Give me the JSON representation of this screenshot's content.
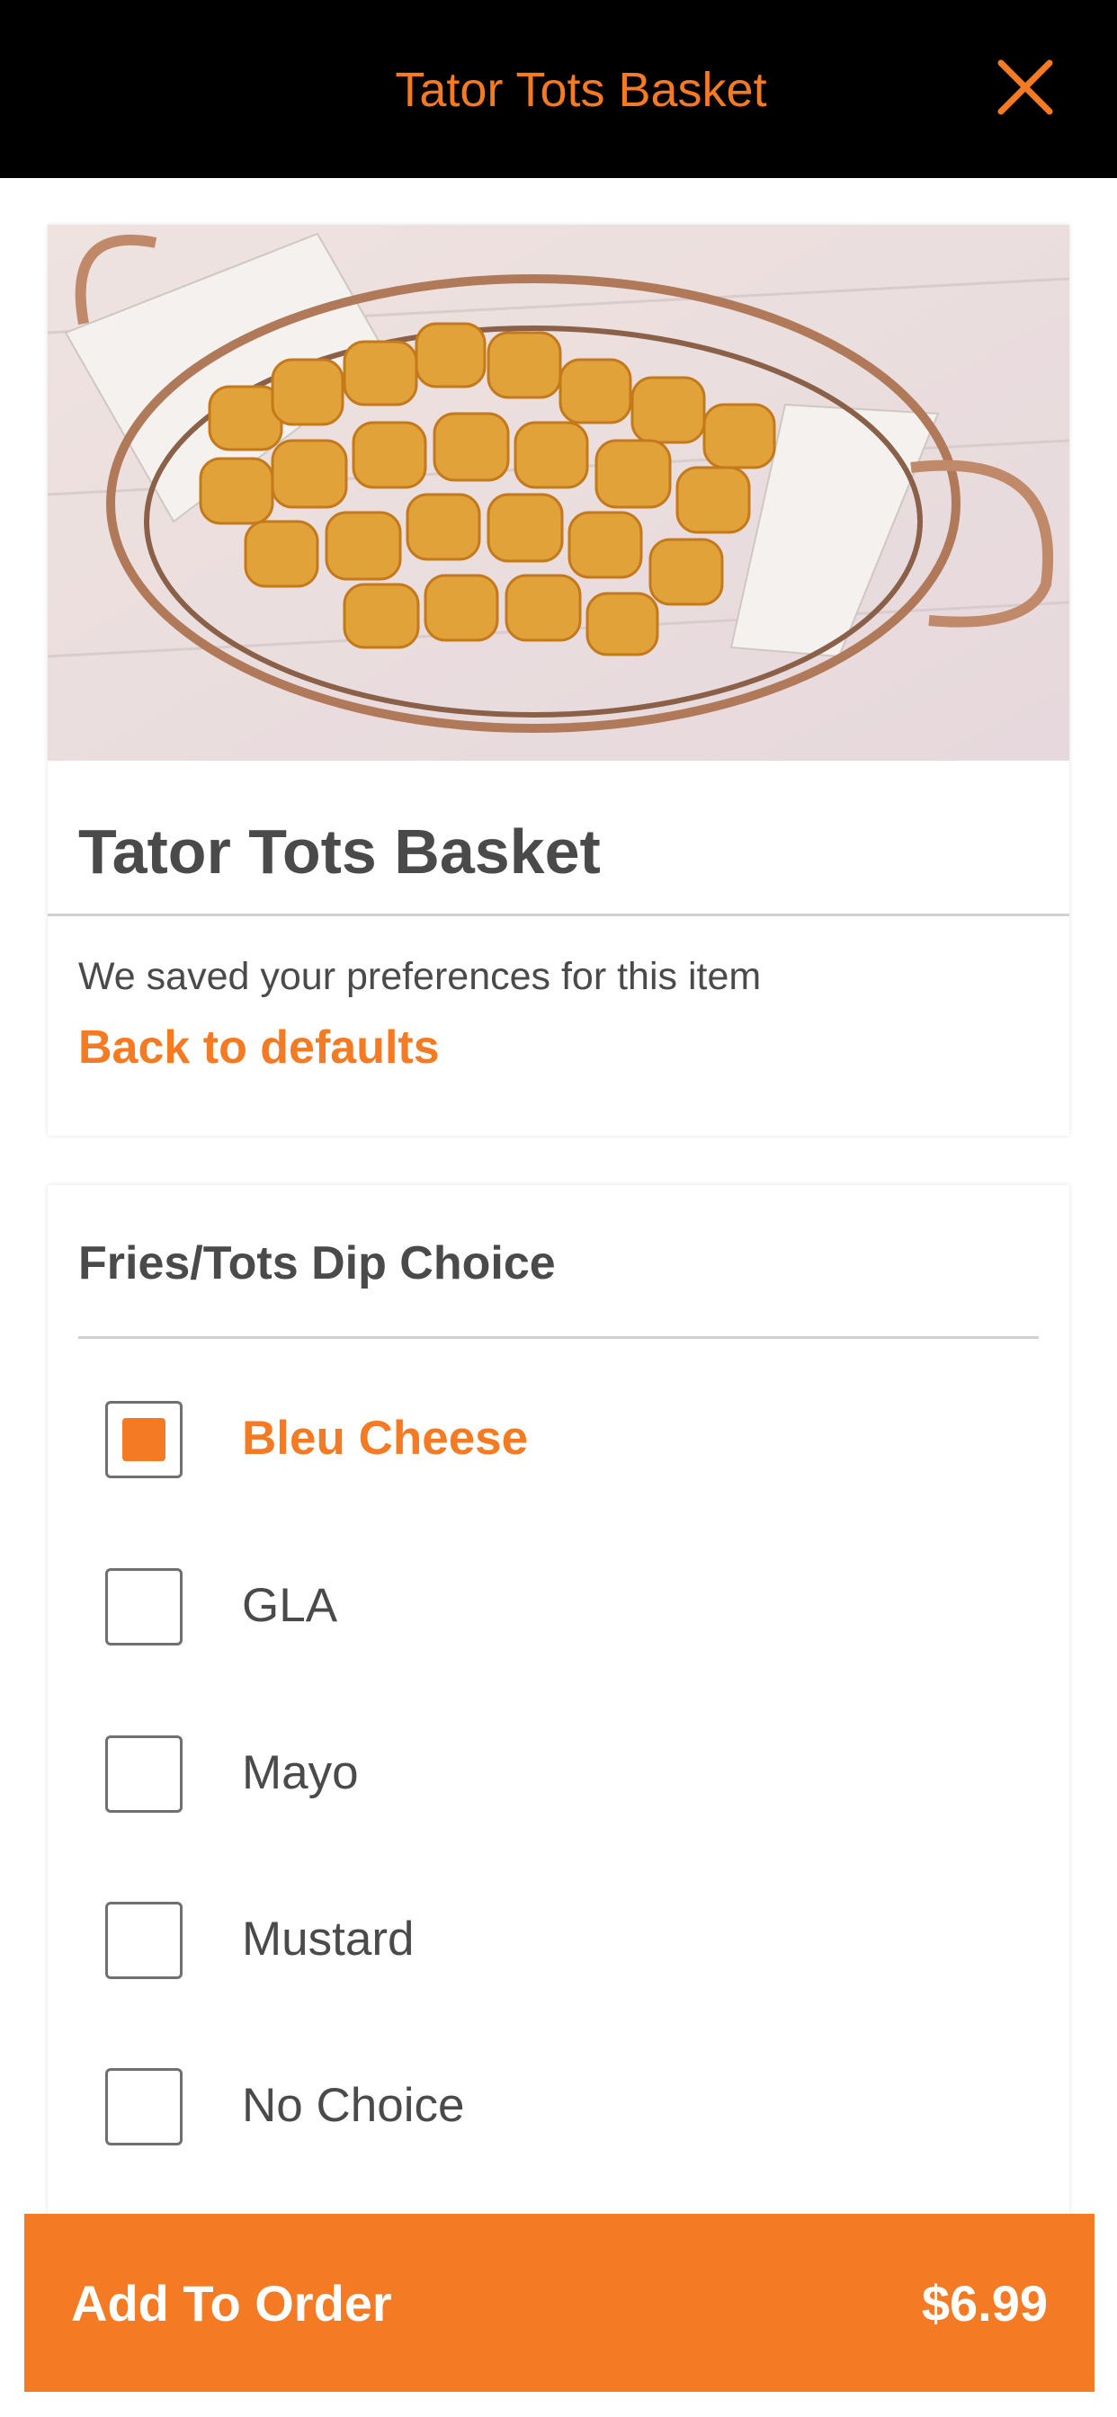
{
  "header": {
    "title": "Tator Tots Basket",
    "close_icon": "close-icon"
  },
  "item": {
    "image_icon": "food-photo",
    "title": "Tator Tots Basket",
    "preferences_message": "We saved your preferences for this item",
    "back_to_defaults": "Back to defaults"
  },
  "options_section": {
    "title": "Fries/Tots Dip Choice",
    "options": [
      {
        "label": "Bleu Cheese",
        "selected": true
      },
      {
        "label": "GLA",
        "selected": false
      },
      {
        "label": "Mayo",
        "selected": false
      },
      {
        "label": "Mustard",
        "selected": false
      },
      {
        "label": "No Choice",
        "selected": false
      }
    ]
  },
  "footer": {
    "add_label": "Add To Order",
    "price": "$6.99"
  },
  "colors": {
    "accent": "#f47a23",
    "header_bg": "#000000",
    "text": "#4a4a4a"
  }
}
